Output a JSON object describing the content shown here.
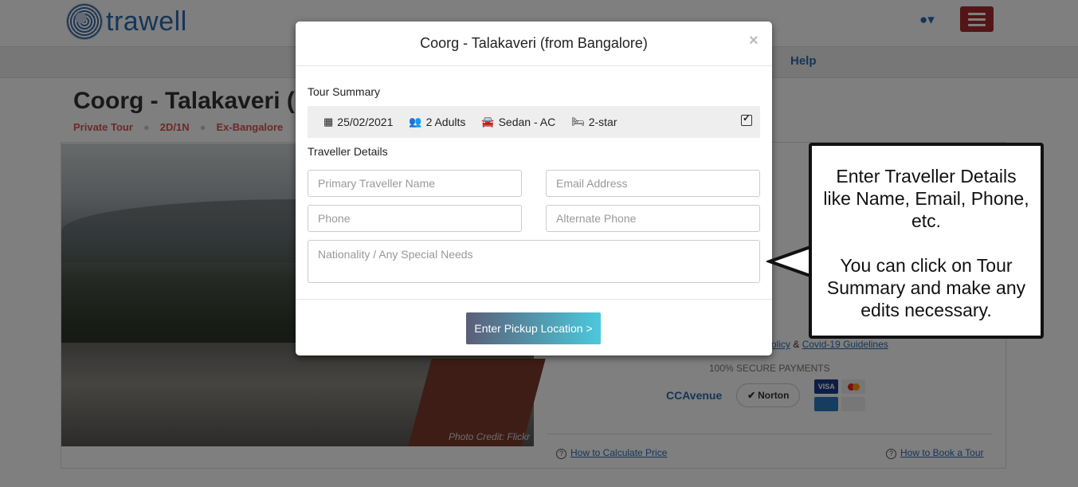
{
  "header": {
    "logo_text": "trawell",
    "help_label": "Help"
  },
  "page": {
    "title": "Coorg - Talakaveri (",
    "tags": [
      "Private Tour",
      "2D/1N",
      "Ex-Bangalore"
    ],
    "photo_credit": "Photo Credit: Flickr",
    "secure_payments": "100% SECURE PAYMENTS",
    "payment_logos": {
      "ccavenue": "CCAvenue",
      "norton": "Norton",
      "visa": "VISA"
    },
    "policy_and": "&",
    "policy_link": "olicy",
    "covid_link": "Covid-19 Guidelines",
    "how_calc_price": "How to Calculate Price",
    "how_book_tour": "How to Book a Tour"
  },
  "modal": {
    "title": "Coorg - Talakaveri (from Bangalore)",
    "close": "×",
    "tour_summary_label": "Tour Summary",
    "summary": {
      "date": "25/02/2021",
      "adults": "2 Adults",
      "vehicle": "Sedan - AC",
      "hotel": "2-star"
    },
    "traveller_details_label": "Traveller Details",
    "fields": {
      "primary_name_placeholder": "Primary Traveller Name",
      "email_placeholder": "Email Address",
      "phone_placeholder": "Phone",
      "alt_phone_placeholder": "Alternate Phone",
      "nationality_placeholder": "Nationality / Any Special Needs"
    },
    "pickup_button": "Enter Pickup Location >"
  },
  "callout": {
    "line1": "Enter Traveller Details like Name, Email, Phone, etc.",
    "line2": "You can click on Tour Summary and make any edits necessary."
  },
  "colors": {
    "brand_blue": "#2a6bb0",
    "menu_red": "#a82a2e",
    "tag_red": "#d9534f",
    "button_gradient_start": "#5a5f78",
    "button_gradient_end": "#4cc9dc"
  }
}
